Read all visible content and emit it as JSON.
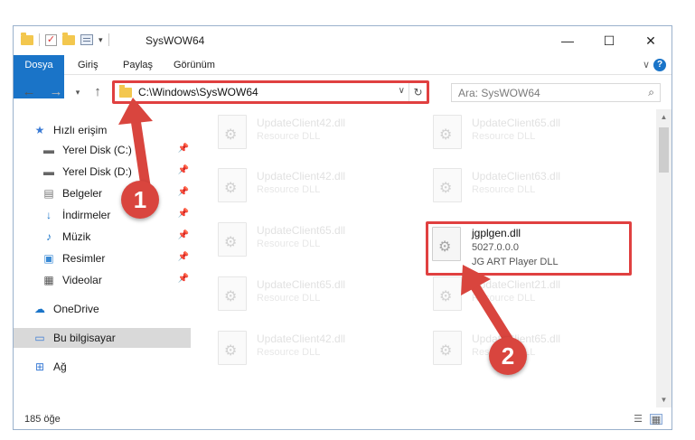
{
  "window": {
    "title": "SysWOW64",
    "minimize_symbol": "—",
    "maximize_symbol": "☐",
    "close_symbol": "✕"
  },
  "ribbon": {
    "tabs": [
      "Dosya",
      "Giriş",
      "Paylaş",
      "Görünüm"
    ],
    "help_symbol": "?"
  },
  "navigation": {
    "address": "C:\\Windows\\SysWOW64",
    "search_placeholder": "Ara: SysWOW64"
  },
  "sidebar": {
    "items": [
      {
        "label": "Hızlı erişim",
        "icon": "star-icon",
        "pinned": false
      },
      {
        "label": "Yerel Disk (C:)",
        "icon": "drive-icon",
        "pinned": true
      },
      {
        "label": "Yerel Disk (D:)",
        "icon": "drive-icon",
        "pinned": true
      },
      {
        "label": "Belgeler",
        "icon": "documents-icon",
        "pinned": true
      },
      {
        "label": "İndirmeler",
        "icon": "download-icon",
        "pinned": true
      },
      {
        "label": "Müzik",
        "icon": "music-icon",
        "pinned": true
      },
      {
        "label": "Resimler",
        "icon": "pictures-icon",
        "pinned": true
      },
      {
        "label": "Videolar",
        "icon": "videos-icon",
        "pinned": true
      },
      {
        "label": "OneDrive",
        "icon": "cloud-icon",
        "pinned": false
      },
      {
        "label": "Bu bilgisayar",
        "icon": "computer-icon",
        "pinned": false,
        "selected": true
      },
      {
        "label": "Ağ",
        "icon": "network-icon",
        "pinned": false
      }
    ]
  },
  "files": [
    {
      "name": "UpdateClient42.dll",
      "desc": "Resource DLL"
    },
    {
      "name": "UpdateClient65.dll",
      "desc": "Resource DLL"
    },
    {
      "name": "UpdateClient42.dll",
      "desc": "Resource DLL"
    },
    {
      "name": "UpdateClient63.dll",
      "desc": "Resource DLL"
    },
    {
      "name": "UpdateClient65.dll",
      "desc": "Resource DLL"
    },
    {
      "name": "UpdateClient65.dll",
      "desc": "Resource DLL"
    },
    {
      "name": "UpdateClient21.dll",
      "desc": "Resource DLL"
    },
    {
      "name": "UpdateClient42.dll",
      "desc": "Resource DLL"
    },
    {
      "name": "UpdateClient65.dll",
      "desc": "Resource DLL"
    }
  ],
  "highlighted_file": {
    "name": "jgplgen.dll",
    "version": "5027.0.0.0",
    "desc": "JG ART Player DLL"
  },
  "status": {
    "count": "185 öğe"
  },
  "annotations": {
    "step1": "1",
    "step2": "2",
    "color": "#d9453e"
  }
}
